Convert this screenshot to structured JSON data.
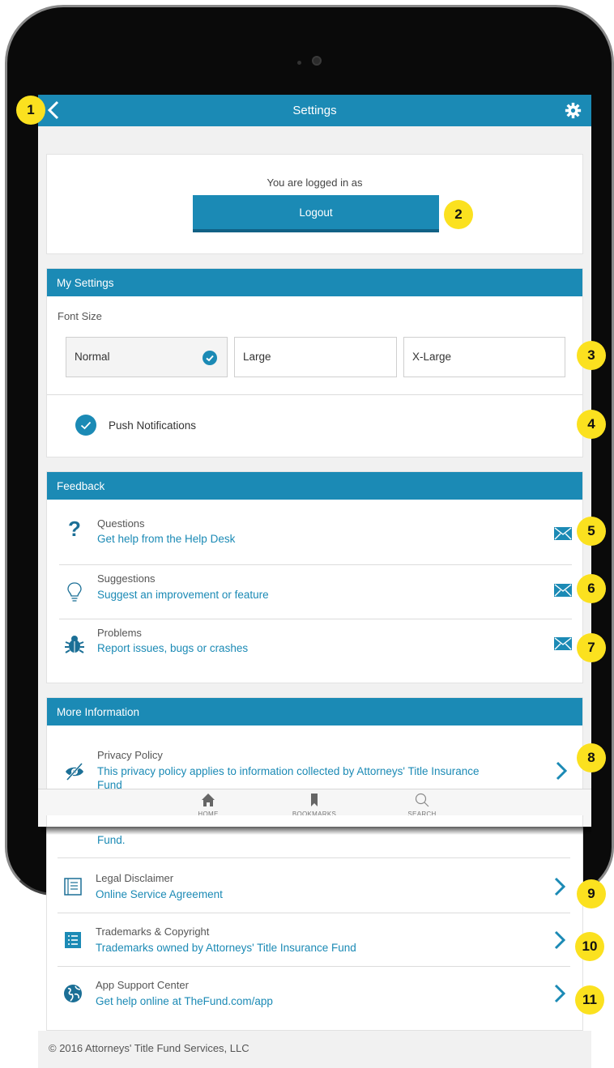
{
  "header": {
    "title": "Settings"
  },
  "account": {
    "logged_in_text": "You are logged in as",
    "logout_label": "Logout"
  },
  "my_settings": {
    "title": "My Settings",
    "font_size_label": "Font Size",
    "options": [
      "Normal",
      "Large",
      "X-Large"
    ],
    "selected": "Normal",
    "push_label": "Push Notifications",
    "push_enabled": true
  },
  "feedback": {
    "title": "Feedback",
    "items": [
      {
        "title": "Questions",
        "subtitle": "Get help from the Help Desk",
        "icon": "question-icon"
      },
      {
        "title": "Suggestions",
        "subtitle": "Suggest an improvement or feature",
        "icon": "lightbulb-icon"
      },
      {
        "title": "Problems",
        "subtitle": "Report issues, bugs or crashes",
        "icon": "bug-icon"
      }
    ]
  },
  "more_info": {
    "title": "More Information",
    "items": [
      {
        "title": "Privacy Policy",
        "subtitle": "This privacy policy applies to information collected by Attorneys' Title Insurance",
        "subtitle_tail": "Fund",
        "icon": "eye-slash-icon"
      },
      {
        "title": "Legal Disclaimer",
        "subtitle": "Online Service Agreement",
        "icon": "document-icon"
      },
      {
        "title": "Trademarks & Copyright",
        "subtitle": "Trademarks owned by Attorneys' Title Insurance Fund",
        "icon": "list-icon"
      },
      {
        "title": "App Support Center",
        "subtitle": "Get help online at TheFund.com/app",
        "icon": "globe-icon"
      }
    ],
    "overflow_tail": "Fund."
  },
  "tabbar": {
    "tabs": [
      "HOME",
      "BOOKMARKS",
      "SEARCH"
    ]
  },
  "footer": {
    "copyright": "© 2016 Attorneys' Title Fund Services, LLC"
  },
  "callouts": [
    "1",
    "2",
    "3",
    "4",
    "5",
    "6",
    "7",
    "8",
    "9",
    "10",
    "11"
  ],
  "colors": {
    "accent": "#1b8ab5",
    "badge": "#fbe11f"
  }
}
